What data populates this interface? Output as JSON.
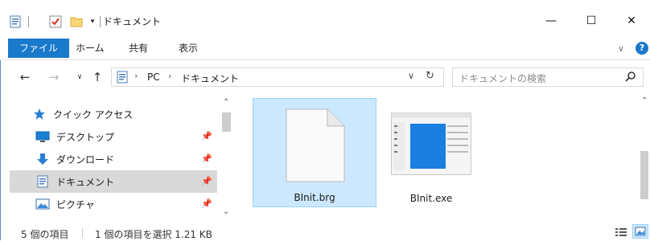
{
  "window": {
    "title": "ドキュメント",
    "controls": {
      "minimize": "—",
      "maximize": "☐",
      "close": "✕"
    }
  },
  "ribbon": {
    "tabs": [
      "ファイル",
      "ホーム",
      "共有",
      "表示"
    ]
  },
  "address": {
    "path": [
      "PC",
      "ドキュメント"
    ],
    "search_placeholder": "ドキュメントの検索"
  },
  "nav_pane": {
    "items": [
      {
        "label": "クイック アクセス",
        "icon": "star-icon",
        "pinned": false
      },
      {
        "label": "デスクトップ",
        "icon": "desktop-icon",
        "pinned": true
      },
      {
        "label": "ダウンロード",
        "icon": "download-icon",
        "pinned": true
      },
      {
        "label": "ドキュメント",
        "icon": "document-icon",
        "pinned": true,
        "selected": true
      },
      {
        "label": "ピクチャ",
        "icon": "picture-icon",
        "pinned": true
      }
    ]
  },
  "files": [
    {
      "name": "BInit.brg",
      "type": "generic-file-icon",
      "selected": true
    },
    {
      "name": "BInit.exe",
      "type": "exe-window-icon",
      "selected": false
    }
  ],
  "status": {
    "item_count": "5 個の項目",
    "selection": "1 個の項目を選択  1.21 KB"
  },
  "colors": {
    "accent": "#1979ca",
    "selection_bg": "#cce8ff",
    "selection_border": "#99d1ff",
    "nav_selected": "#d9d9d9"
  }
}
